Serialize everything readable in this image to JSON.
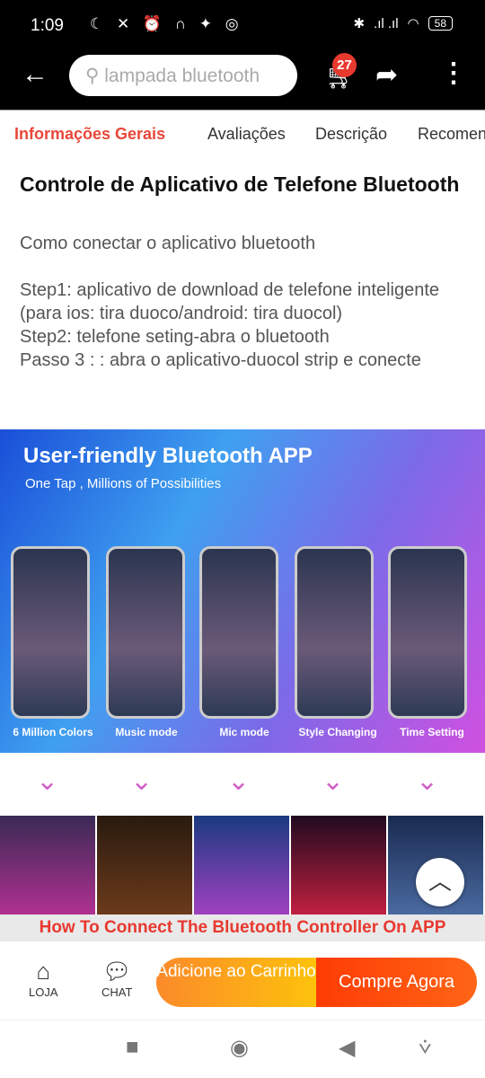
{
  "status": {
    "time": "1:09",
    "battery": "58"
  },
  "header": {
    "search_placeholder": "lampada bluetooth",
    "cart_count": "27"
  },
  "tabs": [
    {
      "label": "Informações Gerais",
      "active": true
    },
    {
      "label": "Avaliações"
    },
    {
      "label": "Descrição"
    },
    {
      "label": "Recomen"
    }
  ],
  "content": {
    "title": "Controle de Aplicativo de Telefone Bluetooth",
    "paragraphs": [
      "Como conectar o aplicativo bluetooth",
      "",
      "Step1: aplicativo de download de telefone inteligente (para ios: tira duoco/android: tira duocol)",
      "Step2: telefone seting-abra o bluetooth",
      "Passo 3 : : abra o aplicativo-duocol strip e conecte"
    ]
  },
  "hero": {
    "title": "User-friendly Bluetooth APP",
    "subtitle": "One Tap , Millions of Possibilities",
    "captions": [
      "6 Million Colors",
      "Music mode",
      "Mic mode",
      "Style Changing",
      "Time Setting"
    ]
  },
  "banner": "How To Connect The Bluetooth Controller On APP",
  "bottom": {
    "store": "LOJA",
    "chat": "CHAT",
    "add_to_cart": "Adicione ao Carrinho",
    "buy_now": "Compre Agora"
  },
  "colors": {
    "accent": "#e8473a",
    "add_cart": "#fb8a2a",
    "buy": "#fe3c04"
  }
}
